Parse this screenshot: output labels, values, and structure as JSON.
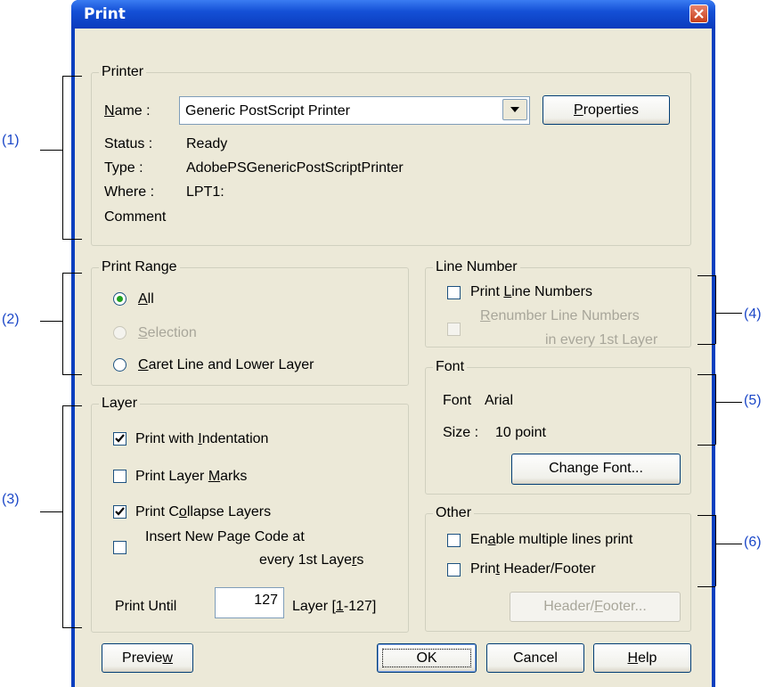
{
  "window": {
    "title": "Print"
  },
  "printer": {
    "group_label": "Printer",
    "name_label": "Name :",
    "name_value": "Generic PostScript Printer",
    "properties_button": "Properties",
    "status_label": "Status :",
    "status_value": "Ready",
    "type_label": "Type :",
    "type_value": "AdobePSGenericPostScriptPrinter",
    "where_label": "Where :",
    "where_value": "LPT1:",
    "comment_label": "Comment"
  },
  "print_range": {
    "group_label": "Print Range",
    "options": [
      {
        "label": "All",
        "selected": true,
        "enabled": true
      },
      {
        "label": "Selection",
        "selected": false,
        "enabled": false
      },
      {
        "label": "Caret Line and Lower Layer",
        "selected": false,
        "enabled": true
      }
    ]
  },
  "line_number": {
    "group_label": "Line Number",
    "print_line_numbers": {
      "label": "Print Line Numbers",
      "checked": false,
      "enabled": true
    },
    "renumber": {
      "label_line1": "Renumber Line Numbers",
      "label_line2": "in every 1st Layer",
      "checked": false,
      "enabled": false
    }
  },
  "font": {
    "group_label": "Font",
    "font_label": "Font",
    "font_value": "Arial",
    "size_label": "Size :",
    "size_value": "10 point",
    "change_font_button": "Change Font..."
  },
  "layer": {
    "group_label": "Layer",
    "print_with_indentation": {
      "label": "Print with Indentation",
      "checked": true
    },
    "print_layer_marks": {
      "label": "Print Layer Marks",
      "checked": false
    },
    "print_collapse_layers": {
      "label": "Print Collapse Layers",
      "checked": true
    },
    "insert_new_page": {
      "label_line1": "Insert New Page Code at",
      "label_line2": "every 1st Layers",
      "checked": false
    },
    "print_until_label": "Print Until",
    "print_until_value": "127",
    "layer_range_label": "Layer [1-127]"
  },
  "other": {
    "group_label": "Other",
    "enable_multiple_lines": {
      "label": "Enable multiple lines print",
      "checked": false
    },
    "print_header_footer": {
      "label": "Print Header/Footer",
      "checked": false
    },
    "header_footer_button": "Header/Footer..."
  },
  "footer_buttons": {
    "preview": "Preview",
    "ok": "OK",
    "cancel": "Cancel",
    "help": "Help"
  },
  "annotations": [
    "(1)",
    "(2)",
    "(3)",
    "(4)",
    "(5)",
    "(6)"
  ],
  "colors": {
    "title_bar": "#0a3bbd",
    "dialog_bg": "#ece9d8",
    "annotation": "#1b47c8",
    "radio_dot": "#21a121"
  }
}
